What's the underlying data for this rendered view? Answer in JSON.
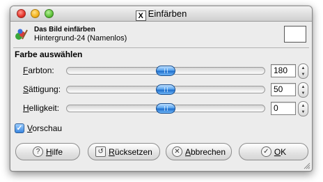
{
  "window": {
    "title": "Einfärben"
  },
  "header": {
    "title": "Das Bild einfärben",
    "subtitle": "Hintergrund-24 (Namenlos)"
  },
  "section": {
    "title": "Farbe auswählen"
  },
  "sliders": [
    {
      "mnemonic": "F",
      "rest": "arbton:",
      "value": "180",
      "fraction": 0.5
    },
    {
      "mnemonic": "S",
      "rest": "ättigung:",
      "value": "50",
      "fraction": 0.5
    },
    {
      "mnemonic": "H",
      "rest": "elligkeit:",
      "value": "0",
      "fraction": 0.5
    }
  ],
  "preview": {
    "mnemonic": "V",
    "rest": "orschau",
    "checked": true
  },
  "buttons": {
    "help": {
      "mnemonic": "H",
      "rest": "ilfe",
      "icon": "help-icon"
    },
    "reset": {
      "mnemonic": "R",
      "rest": "ücksetzen",
      "icon": "reset-icon"
    },
    "cancel": {
      "mnemonic": "A",
      "rest": "bbrechen",
      "icon": "cancel-icon"
    },
    "ok": {
      "mnemonic": "O",
      "rest": "K",
      "icon": "ok-icon"
    }
  }
}
